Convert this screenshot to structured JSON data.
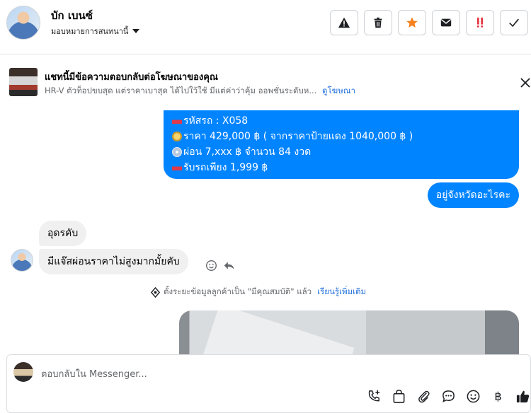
{
  "header": {
    "contact_name": "บัก เบนซ์",
    "stage_label": "มอบหมายการสนทนานี้",
    "actions": [
      {
        "name": "report",
        "icon": "alert-triangle-icon"
      },
      {
        "name": "delete",
        "icon": "trash-icon"
      },
      {
        "name": "star",
        "icon": "star-icon",
        "color": "#f5821f"
      },
      {
        "name": "mark-unread",
        "icon": "envelope-icon"
      },
      {
        "name": "follow-up",
        "icon": "double-exclamation-icon",
        "color": "#e4343f"
      },
      {
        "name": "done",
        "icon": "checkmark-icon"
      }
    ]
  },
  "ad_banner": {
    "title": "แชทนี้มีข้อความตอบกลับต่อโฆษณาของคุณ",
    "subtitle": "HR-V ตัวท็อปขบสุด แต่ราคาเบาสุด ได้ไปใว้ใช้ มีแต่ค่าว่าคุ้ม ออพชั่นระดับห...",
    "link": "ดูโฆษณา"
  },
  "messages": {
    "sent_details": {
      "lines": [
        {
          "icon": "car-emoji",
          "text": "รหัสรถ : X058"
        },
        {
          "icon": "coin-emoji",
          "text": "ราคา 429,000 ฿ ( จากราคาป้ายแดง 1040,000 ฿ )"
        },
        {
          "icon": "disc-emoji",
          "text": "ผ่อน 7,xxx ฿  จำนวน 84 งวด"
        },
        {
          "icon": "car-emoji",
          "text": "รับรถเพียง 1,999 ฿"
        }
      ]
    },
    "sent_question": "อยู่จังหวัดอะไรคะ",
    "received_1": "อุดรคับ",
    "received_2": "มีแจ๊สผ่อนราคาไม่สูงมากมั้ยคับ",
    "system_note": "ตั้งระยะข้อมูลลูกค้าเป็น \"มีคุณสมบัติ\" แล้ว",
    "system_link": "เรียนรู้เพิ่มเติม"
  },
  "composer": {
    "placeholder": "ตอบกลับใน Messenger...",
    "tools": [
      "phone-plus-icon",
      "shopping-bag-icon",
      "paperclip-icon",
      "speech-bubble-icon",
      "emoji-icon",
      "baht-icon",
      "thumbs-up-icon"
    ]
  },
  "colors": {
    "messenger_blue": "#0084ff",
    "link_blue": "#216fdb",
    "star_orange": "#f5821f",
    "alert_red": "#e4343f"
  }
}
